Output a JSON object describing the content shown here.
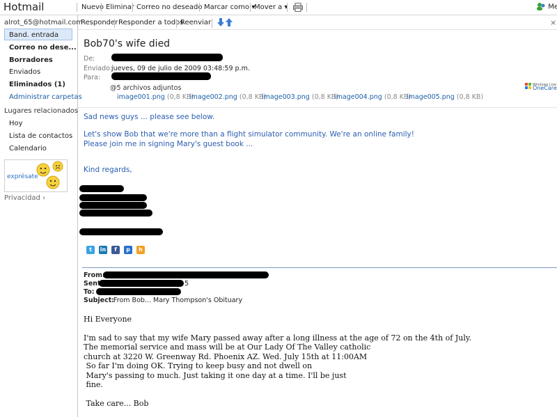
{
  "app": {
    "brand": "Hotmail"
  },
  "toolbar": {
    "new": "Nuevo",
    "delete": "Eliminar",
    "junk": "Correo no deseado",
    "mark_as": "Marcar como",
    "move_to": "Mover a",
    "messenger": "Mes"
  },
  "sidebar": {
    "account": "alrot_65@hotmail.com",
    "folders": [
      {
        "label": "Band. entrada"
      },
      {
        "label": "Correo no dese..."
      },
      {
        "label": "Borradores"
      },
      {
        "label": "Enviados"
      },
      {
        "label": "Eliminados (1)"
      },
      {
        "label": "Administrar carpetas"
      }
    ],
    "related_title": "Lugares relacionados",
    "related": [
      {
        "label": "Hoy"
      },
      {
        "label": "Lista de contactos"
      },
      {
        "label": "Calendario"
      }
    ],
    "ad_label": "exprésate",
    "privacy": "Privacidad"
  },
  "actions": {
    "reply": "Responder",
    "reply_all": "Responder a todos",
    "forward": "Reenviar"
  },
  "message": {
    "subject": "Bob70's wife died",
    "from_label": "De:",
    "sent_label": "Enviado:",
    "sent_value": "jueves, 09 de julio de 2009 03:48:59 p.m.",
    "to_label": "Para:",
    "attachments_title": "5 archivos adjuntos",
    "attachments": [
      {
        "name": "image001.png",
        "size": "(0,8 KB)"
      },
      {
        "name": "image002.png",
        "size": "(0,8 KB)"
      },
      {
        "name": "image003.png",
        "size": "(0,8 KB)"
      },
      {
        "name": "image004.png",
        "size": "(0,8 KB)"
      },
      {
        "name": "image005.png",
        "size": "(0,8 KB)"
      }
    ],
    "onecare_line1": "Windows Live",
    "onecare_line2": "OneCare",
    "body_lines": [
      "Sad news guys ... please see below.",
      "Let's show Bob that we're more than a flight simulator community. We're an online family!",
      "Please join me in signing Mary's guest book ...",
      "Kind regards,"
    ],
    "fw_from_label": "From:",
    "fw_sent_label": "Sent",
    "fw_sent_tail": "5",
    "fw_to_label": "To:",
    "fw_subject_label": "Subject:",
    "fw_subject_value": "From Bob... Mary Thompson's Obituary",
    "fw_body": [
      "Hi Everyone",
      "I'm sad to say that my wife Mary passed away after a long illness at the age of 72 on the 4th of July.",
      "The memorial service and mass will be at Our Lady Of The Valley catholic",
      "church at 3220 W. Greenway Rd. Phoenix AZ. Wed. July 15th at 11:00AM",
      " So far I'm doing OK. Trying to keep busy and not dwell on",
      " Mary's passing to much. Just taking it one day at a time. I'll be just",
      " fine.",
      " Take care... Bob"
    ]
  },
  "colors": {
    "link": "#1d5fa6",
    "body_blue": "#2a5db0",
    "selected_bg": "#dce9f8"
  }
}
